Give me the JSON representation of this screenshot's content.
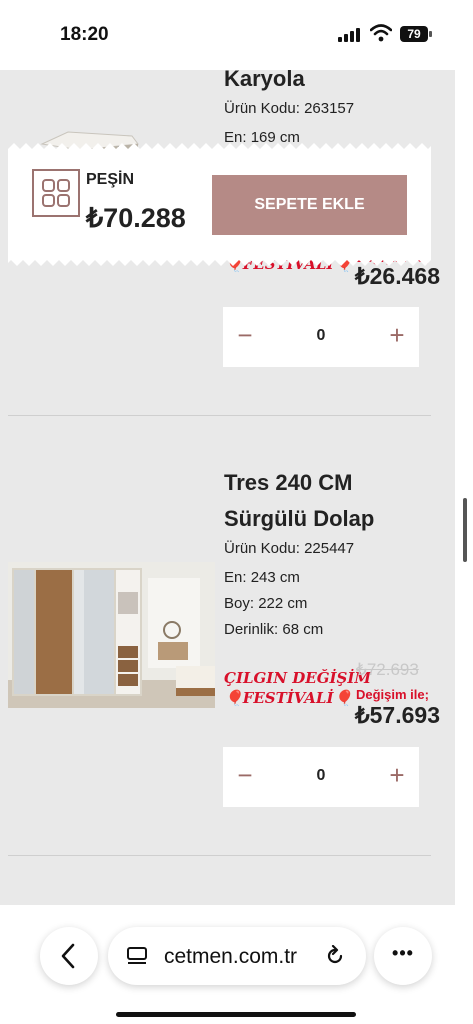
{
  "status_bar": {
    "time": "18:20",
    "battery": "79"
  },
  "products": [
    {
      "title_tail": "Karyola",
      "code_label": "Ürün Kodu:",
      "code": "263157",
      "width_label": "En:",
      "width": "169 cm",
      "festival_bottom": "FESTİVALİ",
      "festival_balloon": "🎈",
      "price_label": "Değişim ile;",
      "new_price": "₺26.468",
      "quantity": "0"
    },
    {
      "title_line1": "Tres 240 CM",
      "title_line2": "Sürgülü Dolap",
      "code_label": "Ürün Kodu:",
      "code": "225447",
      "width_label": "En:",
      "width": "243 cm",
      "height_label": "Boy:",
      "height": "222 cm",
      "depth_label": "Derinlik:",
      "depth": "68 cm",
      "festival_top": "ÇILGIN DEĞİŞİM",
      "festival_bottom": "FESTİVALİ",
      "festival_balloon": "🎈",
      "old_price": "₺72.693",
      "price_label": "Değişim ile;",
      "new_price": "₺57.693",
      "quantity": "0"
    }
  ],
  "qty_controls": {
    "minus": "−",
    "plus": "+"
  },
  "sticky_cart": {
    "payment_label": "PEŞİN",
    "total": "₺70.288",
    "button_label": "SEPETE EKLE"
  },
  "browser": {
    "url": "cetmen.com.tr",
    "back_icon": "chevron-left-icon",
    "reload_icon": "reload-icon",
    "more_icon": "ellipsis-icon",
    "more_label": "•••"
  },
  "colors": {
    "accent": "#b58a86",
    "icon_accent": "#9b6a66",
    "festival_red": "#d8102a",
    "content_bg": "#e9e9e9"
  }
}
